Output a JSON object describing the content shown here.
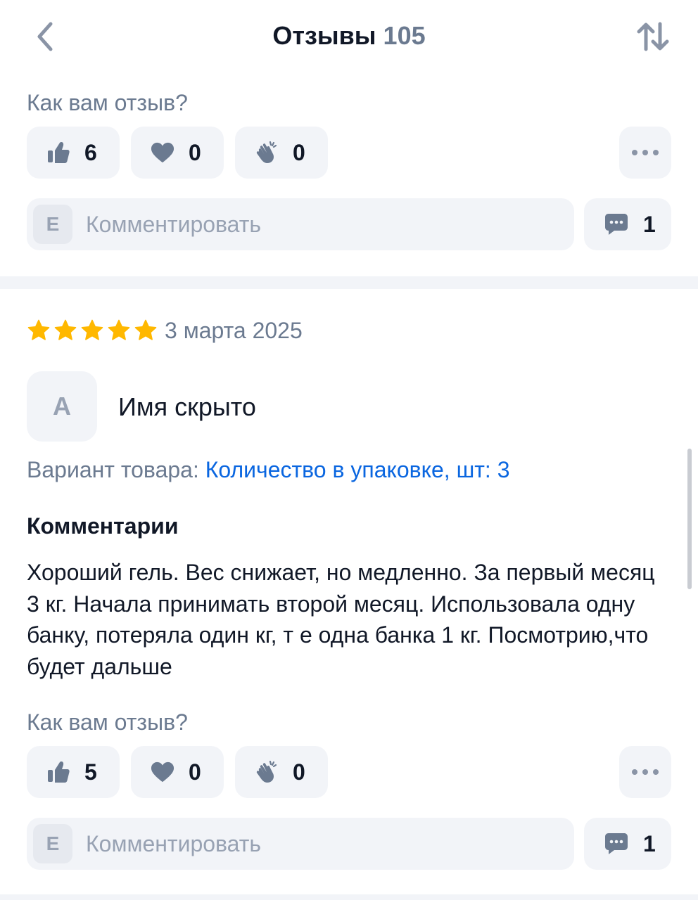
{
  "header": {
    "title": "Отзывы",
    "count": "105",
    "back_icon": "chevron-left-icon",
    "sort_icon": "sort-arrows-icon"
  },
  "labels": {
    "how_do_you_like": "Как вам отзыв?",
    "comment_placeholder": "Комментировать",
    "user_initial": "E",
    "variant_label": "Вариант товара:",
    "comments_heading": "Комментарии"
  },
  "review_prev": {
    "reactions": {
      "like": "6",
      "heart": "0",
      "clap": "0"
    },
    "comments_count": "1"
  },
  "review": {
    "rating": 5,
    "date": "3 марта 2025",
    "avatar_initial": "А",
    "author": "Имя скрыто",
    "variant_value": "Количество в упаковке, шт: 3",
    "text": "Хороший гель. Вес снижает, но медленно. За первый месяц 3 кг. Начала принимать второй месяц. Использовала одну банку, потеряла один кг, т е одна банка 1 кг. Посмотрию,что будет дальше",
    "reactions": {
      "like": "5",
      "heart": "0",
      "clap": "0"
    },
    "comments_count": "1"
  },
  "colors": {
    "accent_link": "#0a66e0",
    "star": "#ffb800",
    "muted_text": "#6b7a90",
    "chip_bg": "#f2f4f8"
  }
}
